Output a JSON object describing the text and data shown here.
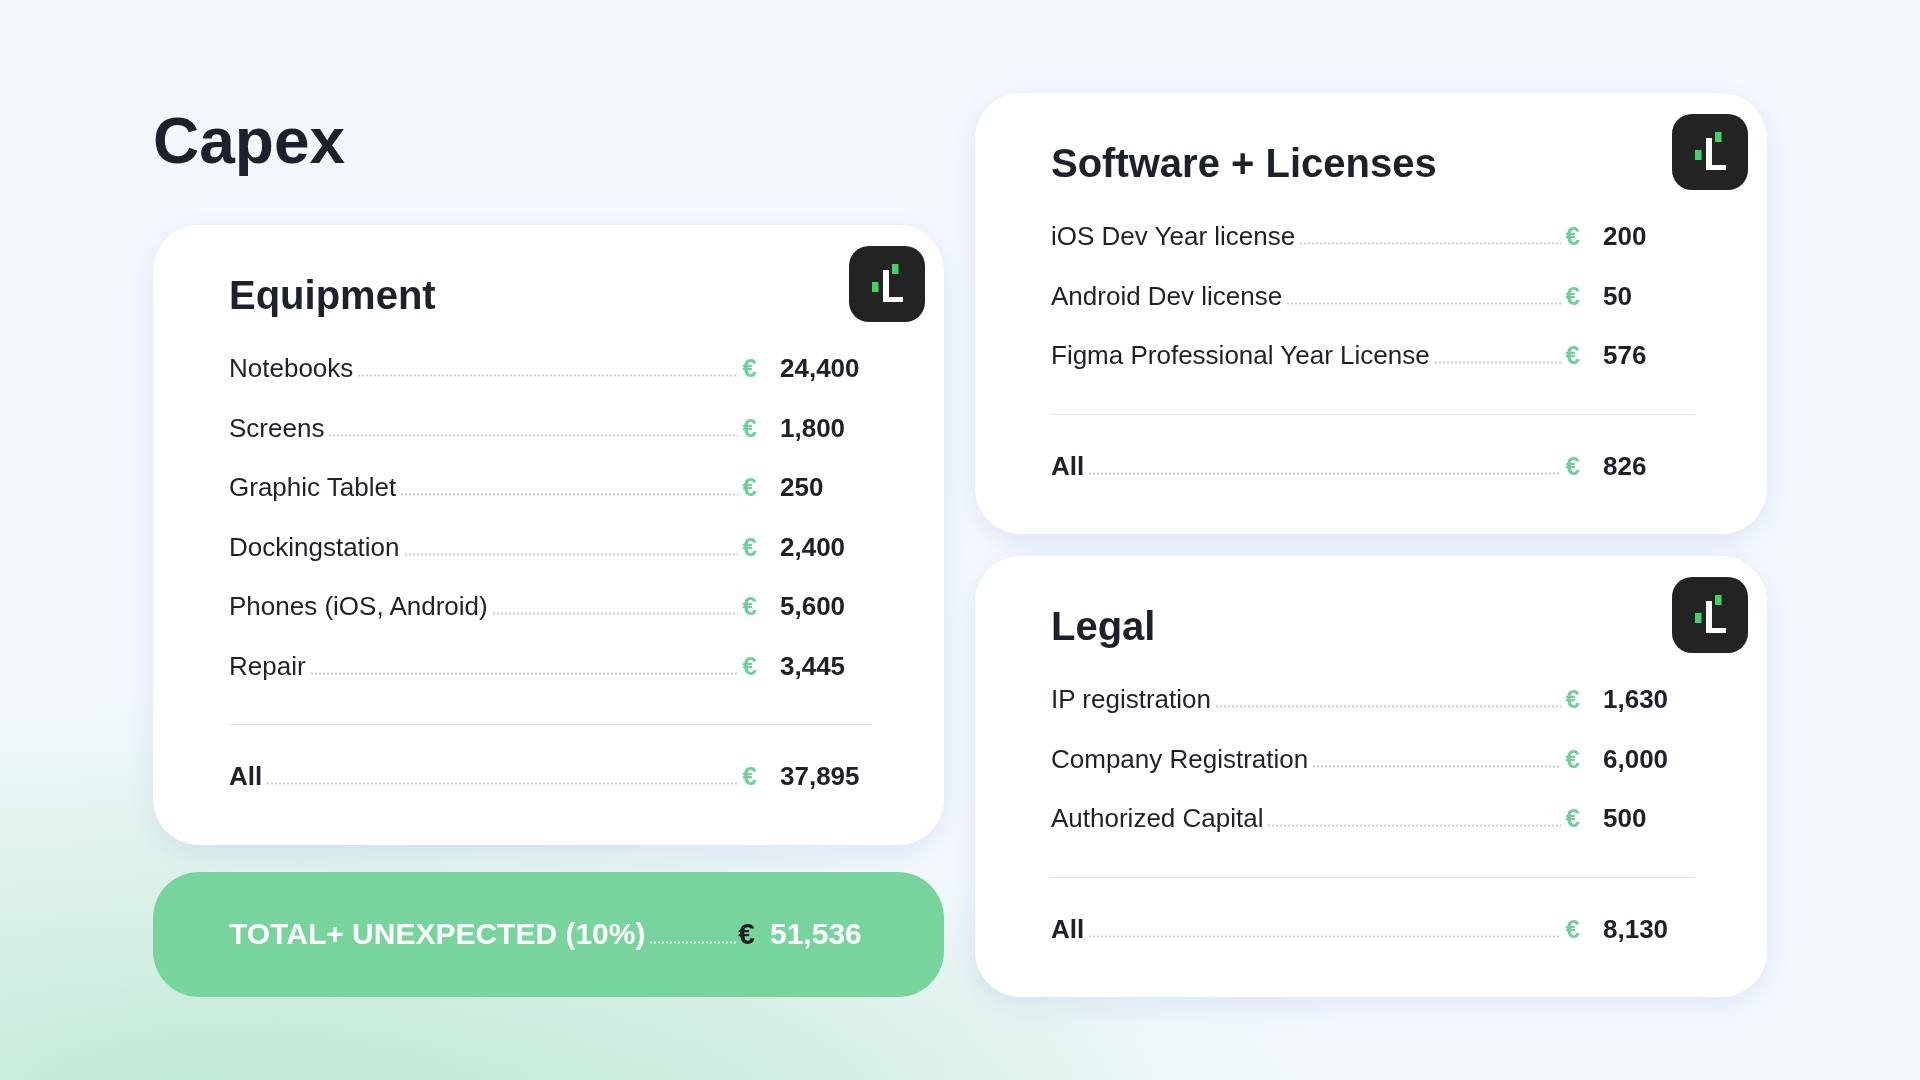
{
  "page": {
    "title": "Capex"
  },
  "cards": [
    {
      "title": "Equipment",
      "items": [
        {
          "label": "Notebooks",
          "currency": "€",
          "amount": "24,400"
        },
        {
          "label": "Screens",
          "currency": "€",
          "amount": "1,800"
        },
        {
          "label": "Graphic Tablet",
          "currency": "€",
          "amount": "250"
        },
        {
          "label": "Dockingstation",
          "currency": "€",
          "amount": "2,400"
        },
        {
          "label": "Phones (iOS, Android)",
          "currency": "€",
          "amount": "5,600"
        },
        {
          "label": "Repair",
          "currency": "€",
          "amount": "3,445"
        }
      ],
      "total": {
        "label": "All",
        "currency": "€",
        "amount": "37,895"
      }
    },
    {
      "title": "Software + Licenses",
      "items": [
        {
          "label": "iOS Dev Year license",
          "currency": "€",
          "amount": "200"
        },
        {
          "label": "Android Dev license",
          "currency": "€",
          "amount": "50"
        },
        {
          "label": "Figma Professional Year License",
          "currency": "€",
          "amount": "576"
        }
      ],
      "total": {
        "label": "All",
        "currency": "€",
        "amount": "826"
      }
    },
    {
      "title": "Legal",
      "items": [
        {
          "label": "IP registration",
          "currency": "€",
          "amount": "1,630"
        },
        {
          "label": "Company Registration",
          "currency": "€",
          "amount": "6,000"
        },
        {
          "label": "Authorized Capital",
          "currency": "€",
          "amount": "500"
        }
      ],
      "total": {
        "label": "All",
        "currency": "€",
        "amount": "8,130"
      }
    }
  ],
  "grand_total": {
    "label": "TOTAL+ UNEXPECTED (10%)",
    "currency": "€",
    "amount": "51,536"
  }
}
